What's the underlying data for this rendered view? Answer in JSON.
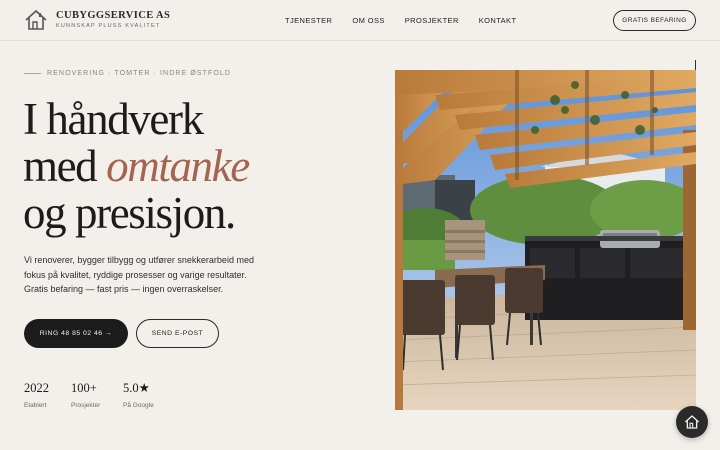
{
  "brand": {
    "name": "CUBYGGSERVICE AS",
    "tagline": "KUNNSKAP PLUSS KVALITET"
  },
  "nav": {
    "items": [
      "TJENESTER",
      "OM OSS",
      "PROSJEKTER",
      "KONTAKT"
    ],
    "cta": "GRATIS BEFARING"
  },
  "hero": {
    "eyebrow": "RENOVERING · TOMTER · INDRE ØSTFOLD",
    "headline_line1": "I håndverk",
    "headline_line2_prefix": "med ",
    "headline_accent": "omtanke",
    "headline_line3": "og presisjon.",
    "lead": "Vi renoverer, bygger tilbygg og utfører snekkerarbeid med fokus på kvalitet, ryddige prosesser og varige resultater. Gratis befaring — fast pris — ingen overraskelser.",
    "primary_button": "RING 48 85 02 46 →",
    "secondary_button": "SEND E-POST"
  },
  "stats": [
    {
      "value": "2022",
      "label": "Etablert"
    },
    {
      "value": "100+",
      "label": "Prosjekter"
    },
    {
      "value": "5.0★",
      "label": "På Google"
    }
  ],
  "icons": {
    "logo": "house-icon",
    "floating": "house-icon"
  },
  "colors": {
    "background": "#f3f0eb",
    "text": "#1c1c1c",
    "accent": "#a3654f",
    "button_dark": "#1c1c1c"
  }
}
